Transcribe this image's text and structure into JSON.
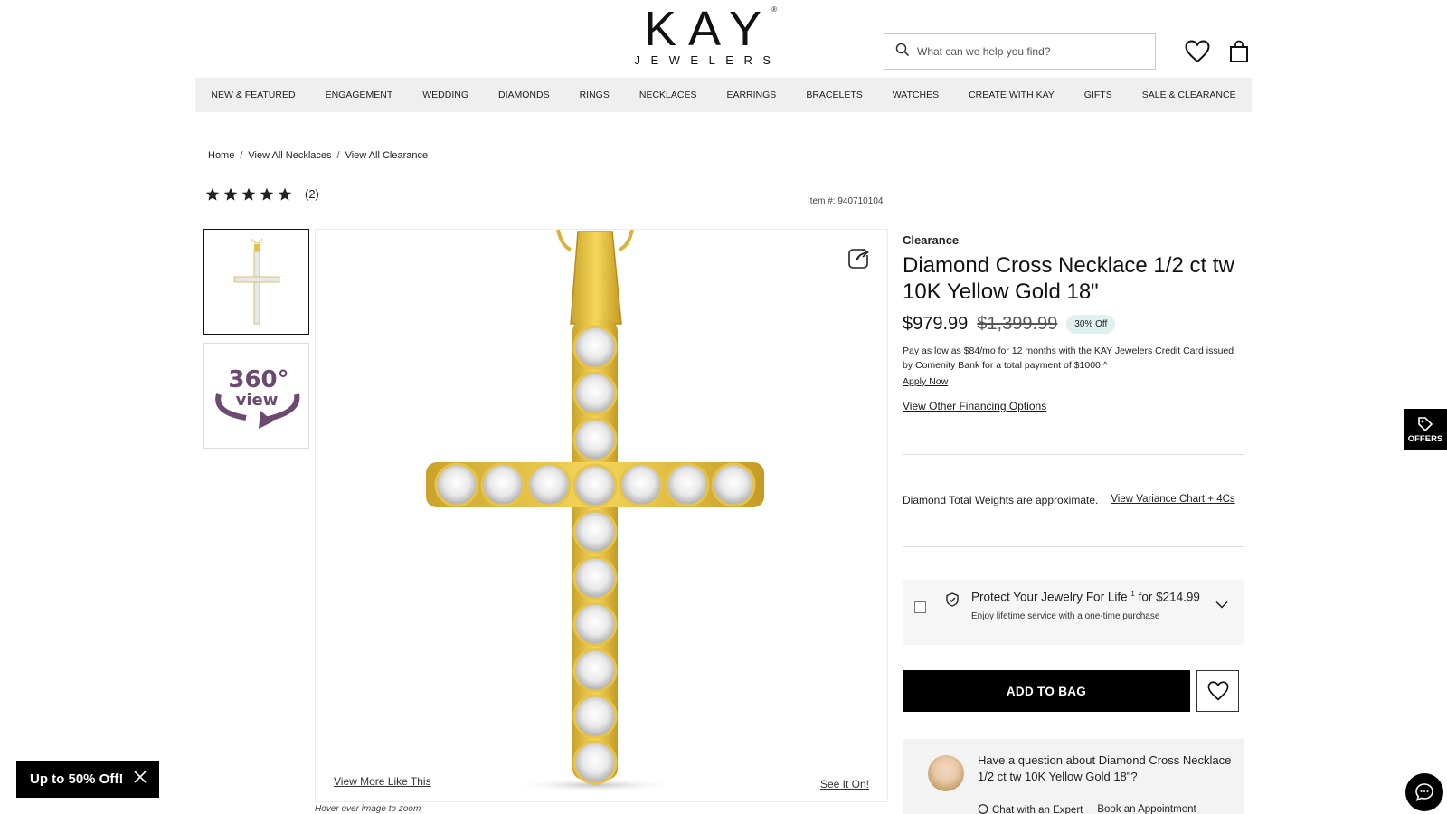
{
  "brand": {
    "name": "KAY",
    "sub": "JEWELERS",
    "reg": "®"
  },
  "search": {
    "placeholder": "What can we help you find?"
  },
  "nav": [
    "NEW & FEATURED",
    "ENGAGEMENT",
    "WEDDING",
    "DIAMONDS",
    "RINGS",
    "NECKLACES",
    "EARRINGS",
    "BRACELETS",
    "WATCHES",
    "CREATE WITH KAY",
    "GIFTS",
    "SALE & CLEARANCE"
  ],
  "breadcrumb": [
    "Home",
    "View All Necklaces",
    "View All Clearance"
  ],
  "rating": {
    "stars": 5,
    "count": "(2)"
  },
  "item_number": "Item #: 940710104",
  "gallery": {
    "thumb_360": {
      "top": "360°",
      "bottom": "view"
    },
    "view_more": "View More Like This",
    "see_it_on": "See It On!",
    "hover_note": "Hover over image to zoom"
  },
  "product": {
    "label": "Clearance",
    "title": "Diamond Cross Necklace 1/2 ct tw 10K Yellow Gold 18\"",
    "price": "$979.99",
    "original_price": "$1,399.99",
    "discount": "30% Off",
    "financing": "Pay as low as $84/mo for 12 months with the KAY Jewelers Credit Card issued by Comenity Bank for a total payment of $1000.^",
    "apply_now": "Apply Now",
    "other_financing": "View Other Financing Options",
    "variance_note": "Diamond Total Weights are approximate.",
    "variance_link": "View Variance Chart + 4Cs"
  },
  "protection": {
    "title": "Protect Your Jewelry For Life",
    "sup": "1",
    "price": "for $214.99",
    "subtitle": "Enjoy lifetime service with a one-time purchase"
  },
  "actions": {
    "add_to_bag": "ADD TO BAG"
  },
  "question": {
    "text": "Have a question about Diamond Cross Necklace 1/2 ct tw 10K Yellow Gold 18\"?",
    "chat": "Chat with an Expert",
    "book": "Book an Appointment"
  },
  "offers": {
    "label": "OFFERS"
  },
  "promo": {
    "text": "Up to 50% Off!"
  },
  "colors": {
    "accent_black": "#000000",
    "discount_badge": "#dff1ee",
    "nav_bg": "#efefef",
    "gold": "#e8c23a",
    "purple_360": "#6b4a6f"
  }
}
